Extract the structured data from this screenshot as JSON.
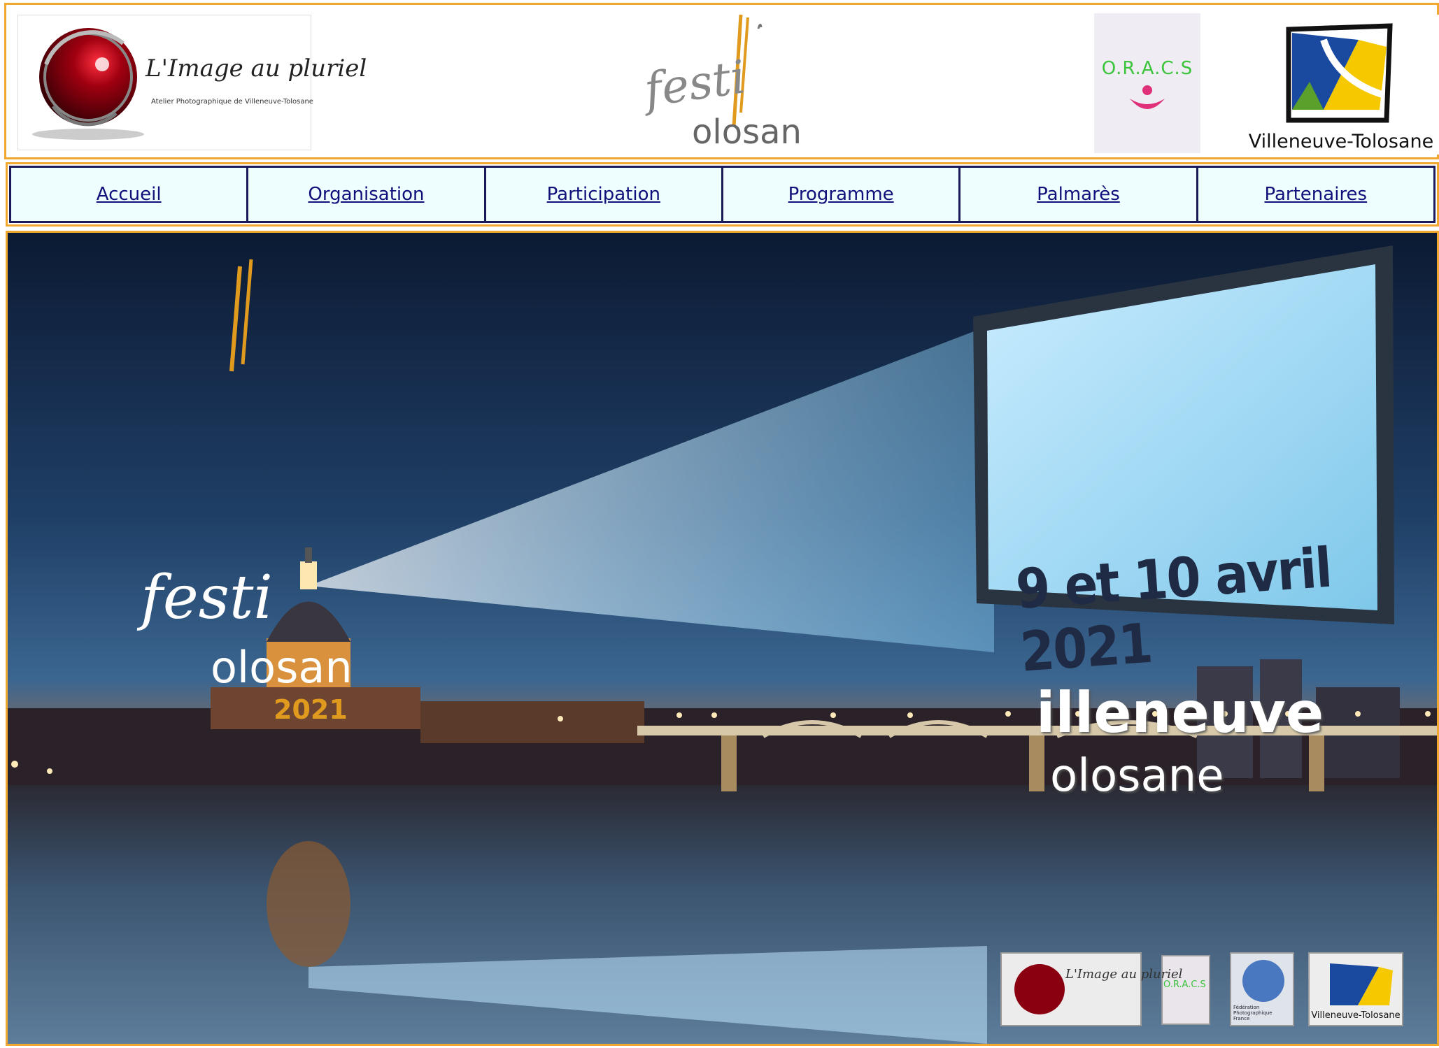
{
  "header": {
    "image_au_pluriel": {
      "title": "L'Image au pluriel",
      "subtitle": "Atelier Photographique de Villeneuve-Tolosane"
    },
    "festival_logo": {
      "line1": "festi",
      "line2": "olosan"
    },
    "oracs_logo": {
      "text": "O.R.A.C.S"
    },
    "villeneuve_logo": {
      "text": "Villeneuve-Tolosane"
    }
  },
  "nav": {
    "items": [
      {
        "label": "Accueil"
      },
      {
        "label": "Organisation"
      },
      {
        "label": "Participation"
      },
      {
        "label": "Programme"
      },
      {
        "label": "Palmarès"
      },
      {
        "label": "Partenaires"
      }
    ]
  },
  "banner": {
    "festival_line1": "festi",
    "festival_line2": "olosan",
    "year": "2021",
    "date": "9 et 10 avril 2021",
    "city_line1": "illeneuve",
    "city_line2": "olosane",
    "footer_logos": {
      "image_au_pluriel": "L'Image au pluriel",
      "oracs": "O.R.A.C.S",
      "fpf": "Fédération Photographique France",
      "villeneuve": "Villeneuve-Tolosane"
    }
  },
  "colors": {
    "frame": "#f0a830",
    "nav_bg": "#eefeff",
    "nav_border": "#1a1a5a",
    "nav_link": "#10107a",
    "accent_orange": "#e09a1e",
    "oracs_green": "#3cc43c",
    "oracs_pink": "#e0307a"
  }
}
